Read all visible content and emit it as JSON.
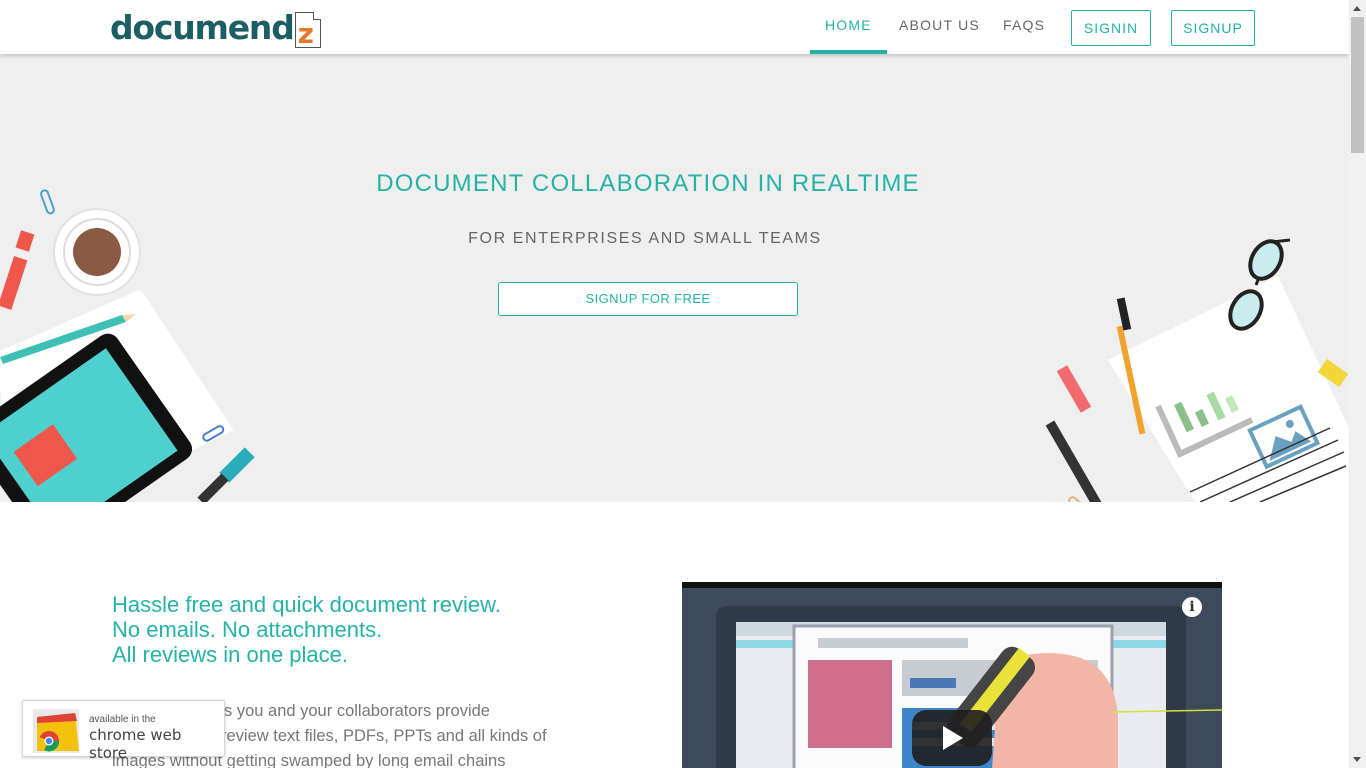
{
  "header": {
    "logo_text": "documend",
    "logo_letter": "z",
    "nav": {
      "home": "HOME",
      "about": "ABOUT US",
      "faqs": "FAQS",
      "signin": "SIGNIN",
      "signup": "SIGNUP"
    },
    "active_nav": "home"
  },
  "hero": {
    "title": "DOCUMENT COLLABORATION IN REALTIME",
    "subtitle": "FOR ENTERPRISES AND SMALL TEAMS",
    "cta_label": "SIGNUP FOR FREE"
  },
  "content": {
    "tagline_lines": [
      "Hassle free and quick document review.",
      "No emails. No attachments.",
      "All reviews in one place."
    ],
    "body_lines": [
      "s you and your collaborators provide",
      "review text files, PDFs, PPTs and all kinds of",
      "images without getting swamped by long email chains"
    ]
  },
  "video": {
    "info_icon": "info-icon",
    "play_icon": "play-icon"
  },
  "chrome_badge": {
    "small_text": "available in the",
    "big_text": "chrome web store"
  },
  "colors": {
    "accent": "#26b3a6",
    "logo": "#1c5f63",
    "hero_bg": "#efefef"
  }
}
